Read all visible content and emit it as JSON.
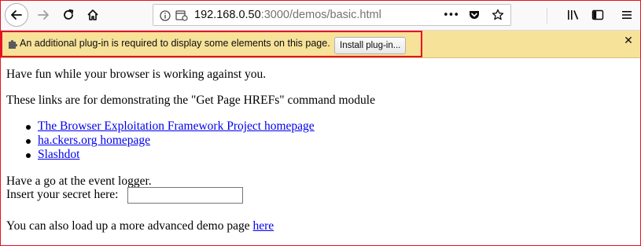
{
  "toolbar": {
    "url_host": "192.168.0.50",
    "url_rest": ":3000/demos/basic.html",
    "more_label": "•••"
  },
  "notification": {
    "message": "An additional plug-in is required to display some elements on this page.",
    "install_label": "Install plug-in...",
    "close_label": "✕"
  },
  "page": {
    "intro": "Have fun while your browser is working against you.",
    "links_intro": "These links are for demonstrating the \"Get Page HREFs\" command module",
    "links": [
      {
        "label": "The Browser Exploitation Framework Project homepage"
      },
      {
        "label": "ha.ckers.org homepage"
      },
      {
        "label": "Slashdot"
      }
    ],
    "event_logger": "Have a go at the event logger.",
    "secret_label": "Insert your secret here:",
    "secret_value": "",
    "advanced_prefix": "You can also load up a more advanced demo page ",
    "advanced_link": "here"
  },
  "icons": {
    "back": "back-arrow-icon",
    "forward": "forward-arrow-icon",
    "reload": "reload-icon",
    "home": "home-icon",
    "info": "info-icon",
    "page": "page-icon",
    "pocket": "pocket-icon",
    "bookmark": "star-icon",
    "library": "library-icon",
    "sidebar": "sidebar-icon",
    "menu": "hamburger-menu-icon",
    "plugin": "puzzle-piece-icon"
  },
  "colors": {
    "notification_bg": "#f7e29a",
    "highlight_border": "#e81123",
    "link": "#0000ee"
  }
}
